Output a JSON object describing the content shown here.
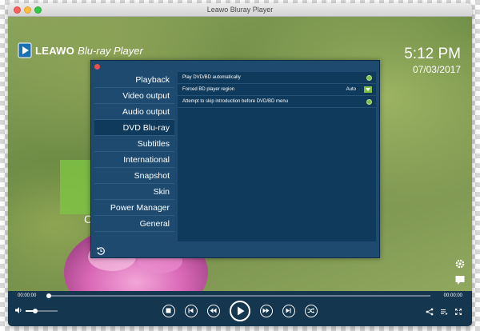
{
  "window": {
    "title": "Leawo Bluray Player"
  },
  "overlay": {
    "logo_brand": "LEAWO",
    "logo_product": "Blu-ray Player",
    "time": "5:12 PM",
    "date": "07/03/2017",
    "partial_letter": "C"
  },
  "settings": {
    "nav_items": [
      {
        "label": "Playback",
        "active": false
      },
      {
        "label": "Video output",
        "active": false
      },
      {
        "label": "Audio output",
        "active": false
      },
      {
        "label": "DVD  Blu-ray",
        "active": true
      },
      {
        "label": "Subtitles",
        "active": false
      },
      {
        "label": "International",
        "active": false
      },
      {
        "label": "Snapshot",
        "active": false
      },
      {
        "label": "Skin",
        "active": false
      },
      {
        "label": "Power Manager",
        "active": false
      },
      {
        "label": "General",
        "active": false
      }
    ],
    "options": [
      {
        "label": "Play DVD/BD automatically",
        "control": "radio"
      },
      {
        "label": "Forced BD player region",
        "control": "select",
        "value": "Auto"
      },
      {
        "label": "Attempt to skip introduction before DVD/BD menu",
        "control": "radio"
      }
    ]
  },
  "player": {
    "time_elapsed": "00:00:00",
    "time_total": "00:00:00",
    "progress": 0.0,
    "volume": 0.3
  },
  "colors": {
    "accent_green": "#7cc142",
    "dialog_bg": "#1d4a6e",
    "control_bar": "#15364f"
  },
  "icons": {
    "settings": "gear-icon",
    "chat": "chat-icon",
    "reset": "reset-icon"
  }
}
